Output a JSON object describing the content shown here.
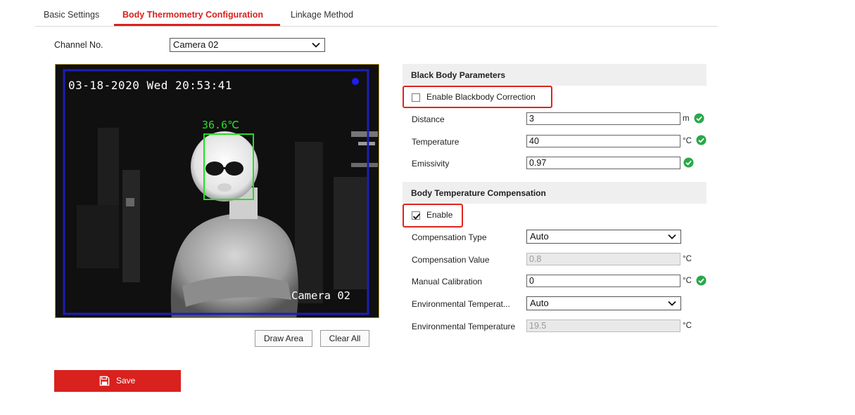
{
  "tabs": [
    {
      "label": "Basic Settings"
    },
    {
      "label": "Body Thermometry Configuration"
    },
    {
      "label": "Linkage Method"
    }
  ],
  "channel": {
    "label": "Channel No.",
    "value": "Camera 02"
  },
  "video": {
    "timestamp": "03-18-2020 Wed 20:53:41",
    "camera_label": "Camera 02",
    "face_temperature": "36.6℃"
  },
  "buttons": {
    "draw_area": "Draw Area",
    "clear_all": "Clear All",
    "save": "Save"
  },
  "black_body": {
    "header": "Black Body Parameters",
    "enable_label": "Enable Blackbody Correction",
    "enable_checked": false,
    "distance": {
      "label": "Distance",
      "value": "3",
      "unit": "m"
    },
    "temperature": {
      "label": "Temperature",
      "value": "40",
      "unit": "°C"
    },
    "emissivity": {
      "label": "Emissivity",
      "value": "0.97"
    }
  },
  "compensation": {
    "header": "Body Temperature Compensation",
    "enable_label": "Enable",
    "enable_checked": true,
    "type": {
      "label": "Compensation Type",
      "value": "Auto"
    },
    "value": {
      "label": "Compensation Value",
      "value": "0.8",
      "unit": "°C"
    },
    "manual": {
      "label": "Manual Calibration",
      "value": "0",
      "unit": "°C"
    },
    "env_mode": {
      "label": "Environmental Temperat...",
      "value": "Auto"
    },
    "env_temp": {
      "label": "Environmental Temperature",
      "value": "19.5",
      "unit": "°C"
    }
  },
  "colors": {
    "accent": "#d9211d",
    "ok": "#2aa84a",
    "roi": "#1e1eb4",
    "face_box": "#22e022"
  }
}
